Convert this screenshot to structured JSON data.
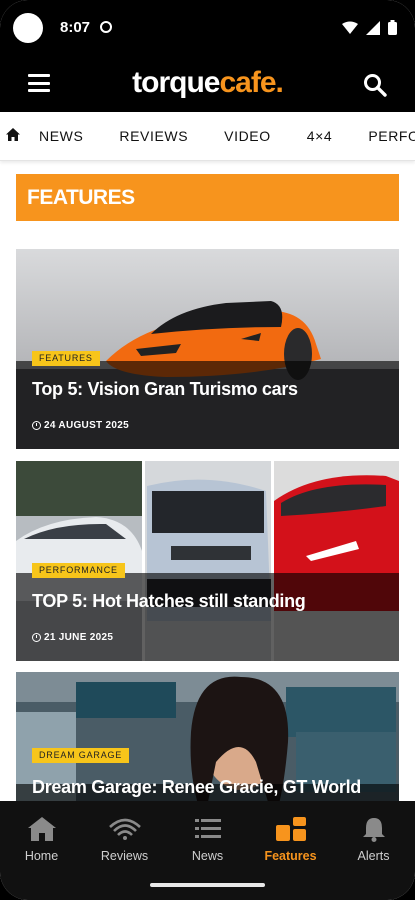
{
  "status": {
    "time": "8:07"
  },
  "header": {
    "logo_part1": "torque",
    "logo_part2": "cafe."
  },
  "nav": {
    "items": [
      "NEWS",
      "REVIEWS",
      "VIDEO",
      "4×4",
      "PERFORMANCE"
    ]
  },
  "section": {
    "title": "FEATURES"
  },
  "articles": [
    {
      "badge": "FEATURES",
      "title": "Top 5: Vision Gran Turismo cars",
      "date": "24 AUGUST 2025"
    },
    {
      "badge": "PERFORMANCE",
      "title": "TOP 5: Hot Hatches still standing",
      "date": "21 JUNE 2025"
    },
    {
      "badge": "DREAM GARAGE",
      "title": "Dream Garage: Renee Gracie, GT World"
    }
  ],
  "bottom_nav": {
    "tabs": [
      {
        "label": "Home",
        "icon": "home-icon"
      },
      {
        "label": "Reviews",
        "icon": "reviews-icon"
      },
      {
        "label": "News",
        "icon": "news-icon"
      },
      {
        "label": "Features",
        "icon": "features-icon",
        "active": true
      },
      {
        "label": "Alerts",
        "icon": "alerts-icon"
      }
    ]
  },
  "colors": {
    "accent": "#f7941d",
    "badge": "#f7c51a",
    "header": "#000000"
  }
}
